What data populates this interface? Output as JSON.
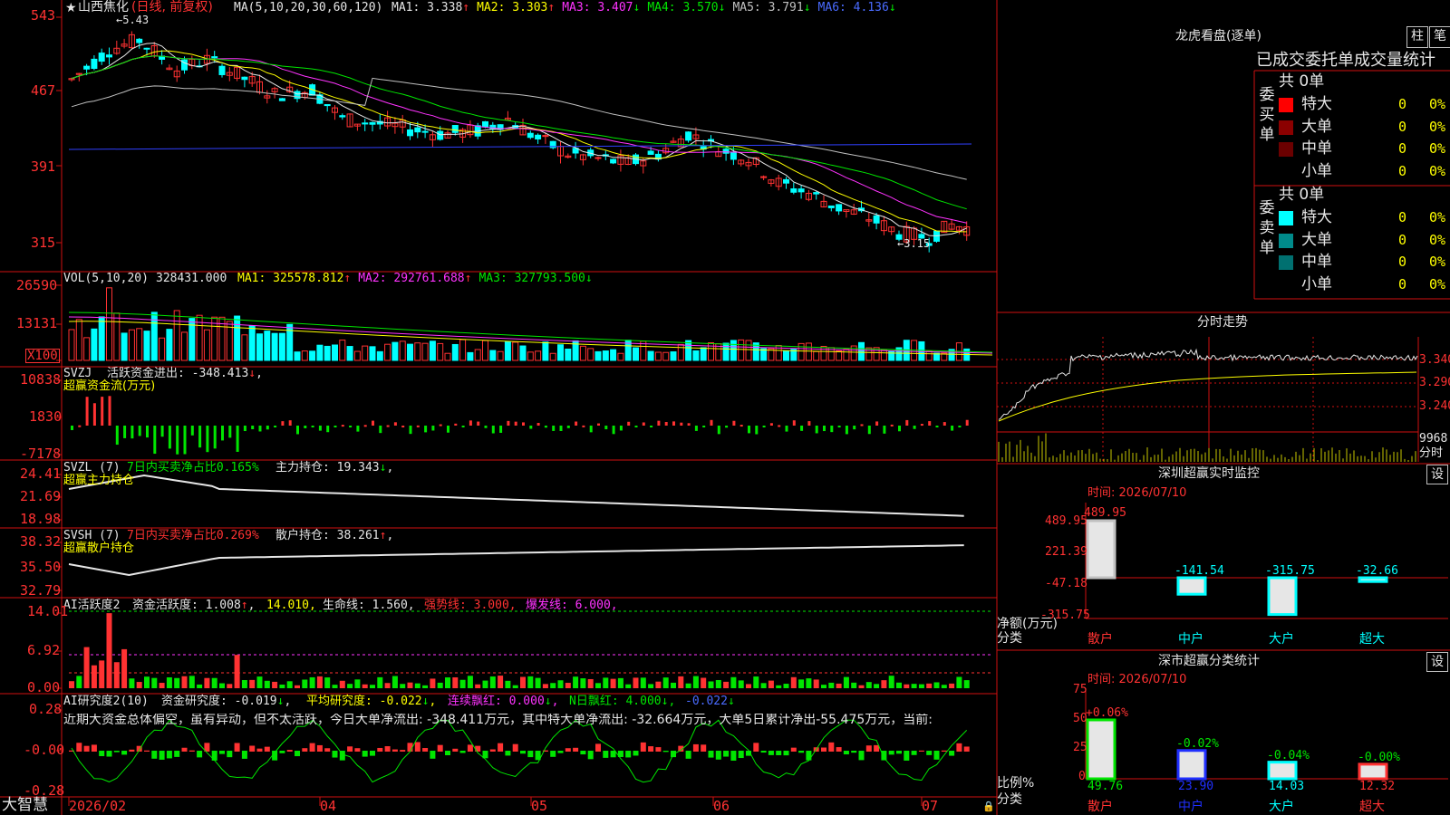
{
  "stock": {
    "name": "山西焦化",
    "period": "(日线, 前复权)"
  },
  "main_panel": {
    "ma_label": "MA(5,10,20,30,60,120)",
    "ma": [
      {
        "label": "MA1: 3.338",
        "arrow": "↑",
        "color": "#e6e6e6"
      },
      {
        "label": "MA2: 3.303",
        "arrow": "↑",
        "color": "#ffff00"
      },
      {
        "label": "MA3: 3.407",
        "arrow": "↓",
        "color": "#ff33ff"
      },
      {
        "label": "MA4: 3.570",
        "arrow": "↓",
        "color": "#00e600"
      },
      {
        "label": "MA5: 3.791",
        "arrow": "↓",
        "color": "#c0c0c0"
      },
      {
        "label": "MA6: 4.136",
        "arrow": "↓",
        "color": "#4a6bff"
      }
    ],
    "y_ticks": [
      "543",
      "467",
      "391",
      "315"
    ],
    "high_label": "5.43",
    "low_label": "3.15"
  },
  "vol_panel": {
    "label": "VOL(5,10,20)",
    "value": "328431.000",
    "ma": [
      {
        "label": "MA1: 325578.812",
        "arrow": "↑",
        "color": "#ffff00"
      },
      {
        "label": "MA2: 292761.688",
        "arrow": "↑",
        "color": "#ff33ff"
      },
      {
        "label": "MA3: 327793.500",
        "arrow": "↓",
        "color": "#00e600"
      }
    ],
    "y_ticks": [
      "26590",
      "13131"
    ],
    "unit": "X100"
  },
  "svzj_panel": {
    "title": "SVZJ",
    "label": "活跃资金进出: -348.413",
    "arrow": "↓",
    "sub": "超赢资金流(万元)",
    "y_ticks": [
      "10838",
      "1830",
      "-7178"
    ]
  },
  "svzl_panel": {
    "title": "SVZL (7)",
    "label1": "7日内买卖净占比0.165%",
    "label2": "主力持仓: 19.343",
    "arrow": "↓",
    "sub": "超赢主力持仓",
    "y_ticks": [
      "24.41",
      "21.69",
      "18.98"
    ]
  },
  "svsh_panel": {
    "title": "SVSH (7)",
    "label1": "7日内买卖净占比0.269%",
    "label2": "散户持仓: 38.261",
    "arrow": "↑",
    "sub": "超赢散户持仓",
    "y_ticks": [
      "38.32",
      "35.50",
      "32.79"
    ]
  },
  "ai_active": {
    "title": "AI活跃度2",
    "label1": "资金活跃度: 1.008",
    "arrow1": "↑",
    "label2": "14.010,",
    "label3": "生命线: 1.560,",
    "label4": "强势线: 3.000,",
    "label5": "爆发线: 6.000,",
    "y_ticks": [
      "14.01",
      "6.92",
      "0.00"
    ]
  },
  "ai_research": {
    "title": "AI研究度2(10)",
    "label1": "资金研究度: -0.019",
    "arrow1": "↓",
    "label2": "平均研究度: -0.022",
    "arrow2": "↓",
    "label3": "连续飘红: 0.000",
    "arrow3": "↓",
    "label4": "N日飘红: 4.000",
    "arrow4": "↓",
    "label5": "-0.022",
    "arrow5": "↓",
    "comment": "近期大资金总体偏空，虽有异动，但不太活跃，今日大单净流出: -348.411万元，其中特大单净流出: -32.664万元，大单5日累计净出-55.475万元，当前:",
    "y_ticks": [
      "0.28",
      "-0.00",
      "-0.28"
    ]
  },
  "x_axis": {
    "labels": [
      "2026/02",
      "04",
      "05",
      "06",
      "07"
    ]
  },
  "brand": "大智慧",
  "right": {
    "lhb_title": "龙虎看盘(逐单)",
    "btn1": "柱",
    "btn2": "笔",
    "order_title": "已成交委托单成交量统计",
    "buy": {
      "side": "委买单",
      "total": "共 0单",
      "rows": [
        {
          "label": "特大",
          "count": "0",
          "pct": "0%",
          "color": "#ff0000"
        },
        {
          "label": "大单",
          "count": "0",
          "pct": "0%",
          "color": "#8b0000"
        },
        {
          "label": "中单",
          "count": "0",
          "pct": "0%",
          "color": "#6b0000"
        },
        {
          "label": "小单",
          "count": "0",
          "pct": "0%",
          "color": ""
        }
      ]
    },
    "sell": {
      "side": "委卖单",
      "total": "共 0单",
      "rows": [
        {
          "label": "特大",
          "count": "0",
          "pct": "0%",
          "color": "#00ffff"
        },
        {
          "label": "大单",
          "count": "0",
          "pct": "0%",
          "color": "#008b8b"
        },
        {
          "label": "中单",
          "count": "0",
          "pct": "0%",
          "color": "#007070"
        },
        {
          "label": "小单",
          "count": "0",
          "pct": "0%",
          "color": ""
        }
      ]
    },
    "intraday": {
      "title": "分时走势",
      "y_ticks": [
        "3.340",
        "3.290",
        "3.240"
      ],
      "vol": "9968",
      "vol_unit": "分时"
    },
    "monitor": {
      "title": "深圳超赢实时监控",
      "btn": "设",
      "time": "时间: 2026/07/10",
      "y_ticks": [
        "489.95",
        "221.39",
        "-47.18",
        "-315.75"
      ],
      "ylabel": "净额(万元)",
      "xlabel": "分类",
      "cats": [
        "散户",
        "中户",
        "大户",
        "超大"
      ],
      "values": [
        489.95,
        -141.54,
        -315.75,
        -32.66
      ],
      "value_labels": [
        "489.95",
        "-141.54",
        "-315.75",
        "-32.66"
      ]
    },
    "stats": {
      "title": "深市超赢分类统计",
      "btn": "设",
      "time": "时间: 2026/07/10",
      "y_ticks": [
        "75",
        "50",
        "25",
        "0"
      ],
      "ylabel": "比例%",
      "xlabel": "分类",
      "cats": [
        "散户",
        "中户",
        "大户",
        "超大"
      ],
      "values": [
        49.76,
        23.9,
        14.03,
        12.32
      ],
      "value_labels": [
        "49.76",
        "23.90",
        "14.03",
        "12.32"
      ],
      "change_labels": [
        "+0.06%",
        "-0.02%",
        "-0.04%",
        "-0.00%"
      ]
    }
  }
}
